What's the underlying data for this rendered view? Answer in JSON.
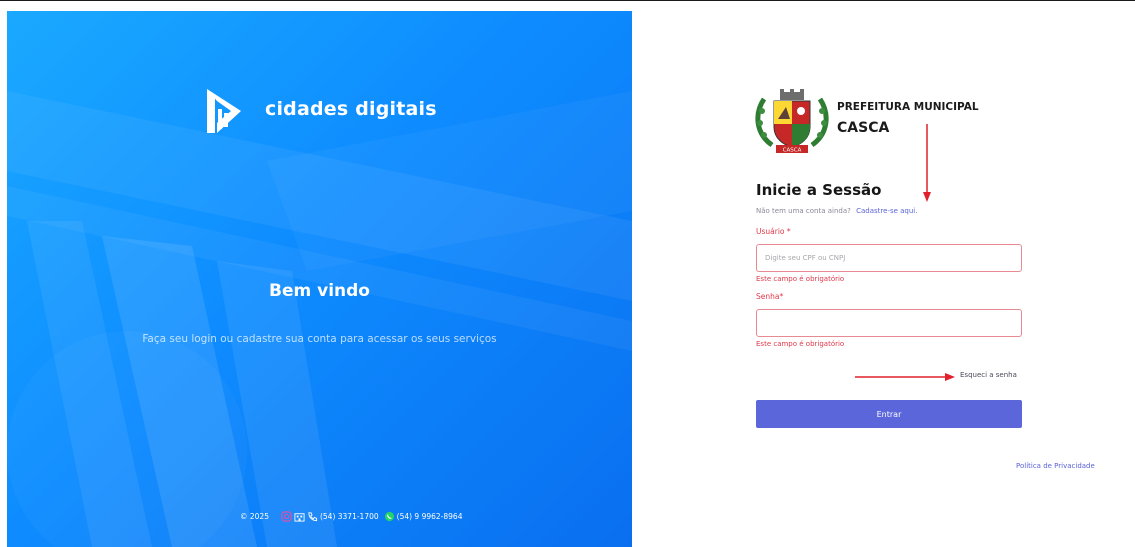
{
  "left_panel": {
    "brand": "cidades digitais",
    "welcome": "Bem vindo",
    "subtitle": "Faça seu login ou cadastre sua conta para acessar os seus serviços",
    "footer": {
      "copyright": "© 2025",
      "phone": "(54) 3371-1700",
      "whatsapp": "(54) 9 9962-8964",
      "icons": [
        "instagram-icon",
        "building-icon",
        "phone-icon",
        "whatsapp-icon"
      ]
    }
  },
  "right_panel": {
    "header": {
      "organization": "PREFEITURA MUNICIPAL",
      "city": "CASCA",
      "crest_text": "CASCA"
    },
    "form": {
      "title": "Inicie a Sessão",
      "no_account": "Não tem uma conta ainda?",
      "signup_link": "Cadastre-se aqui.",
      "user_label": "Usuário",
      "user_required": "*",
      "user_placeholder": "Digite seu CPF ou CNPJ",
      "user_error": "Este campo é obrigatório",
      "password_label": "Senha",
      "password_required": "*",
      "password_error": "Este campo é obrigatório",
      "forgot_password": "Esqueci a senha",
      "submit": "Entrar"
    },
    "privacy_link": "Política de Privacidade"
  },
  "colors": {
    "left_gradient_start": "#1aa9ff",
    "left_gradient_end": "#0a6fef",
    "primary_button": "#5a66da",
    "error": "#e0394a",
    "link": "#5a63d9",
    "annotation_arrow": "#e0202a"
  }
}
